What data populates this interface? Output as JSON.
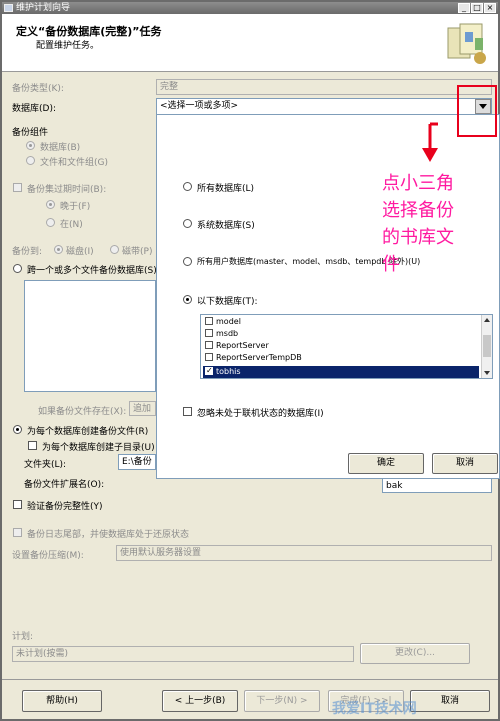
{
  "window": {
    "title": "维护计划向导"
  },
  "header": {
    "title": "定义“备份数据库(完整)”任务",
    "subtitle": "配置维护任务。"
  },
  "form": {
    "backup_type_label": "备份类型(K):",
    "backup_type_value": "完整",
    "database_label": "数据库(D):",
    "database_value": "<选择一项或多项>",
    "backup_component_label": "备份组件",
    "component_database": "数据库(B)",
    "component_files": "文件和文件组(G)",
    "expire_label": "备份集过期时间(B):",
    "expire_after": "晚于(F)",
    "expire_on": "在(N)",
    "backup_to_label": "备份到:",
    "backup_to_disk": "磁盘(I)",
    "backup_to_tape": "磁带(P)",
    "span_files_label": "跨一个或多个文件备份数据库(S):",
    "if_exists_label": "如果备份文件存在(X):",
    "if_exists_value": "追加",
    "per_db_file_label": "为每个数据库创建备份文件(R)",
    "per_db_subdir_label": "为每个数据库创建子目录(U)",
    "folder_label": "文件夹(L):",
    "folder_value": "E:\\备份",
    "extension_label": "备份文件扩展名(O):",
    "extension_value": "bak",
    "verify_label": "验证备份完整性(Y)",
    "log_tail_label": "备份日志尾部，并使数据库处于还原状态",
    "compression_label": "设置备份压缩(M):",
    "compression_value": "使用默认服务器设置",
    "schedule_label": "计划:",
    "schedule_value": "未计划(按需)",
    "change_button": "更改(C)..."
  },
  "popup": {
    "all_databases": "所有数据库(L)",
    "system_databases": "系统数据库(S)",
    "all_user_databases": "所有用户数据库(master、model、msdb、tempdb 除外)(U)",
    "these_databases": "以下数据库(T):",
    "databases": [
      {
        "name": "model",
        "checked": false
      },
      {
        "name": "msdb",
        "checked": false
      },
      {
        "name": "ReportServer",
        "checked": false
      },
      {
        "name": "ReportServerTempDB",
        "checked": false
      },
      {
        "name": "tobhis",
        "checked": true
      }
    ],
    "ignore_offline": "忽略未处于联机状态的数据库(I)",
    "ok_button": "确定",
    "cancel_button": "取消"
  },
  "annotation": {
    "line1": "点小三角",
    "line2": "选择备份",
    "line3": "的书库文",
    "line4": "件",
    "color": "#ff1aa0"
  },
  "footer": {
    "help_button": "帮助(H)",
    "back_button": "< 上一步(B)",
    "next_button": "下一步(N) >",
    "finish_button": "完成(F) >>|",
    "cancel_button": "取消"
  },
  "watermark": "我爱IT技术网"
}
